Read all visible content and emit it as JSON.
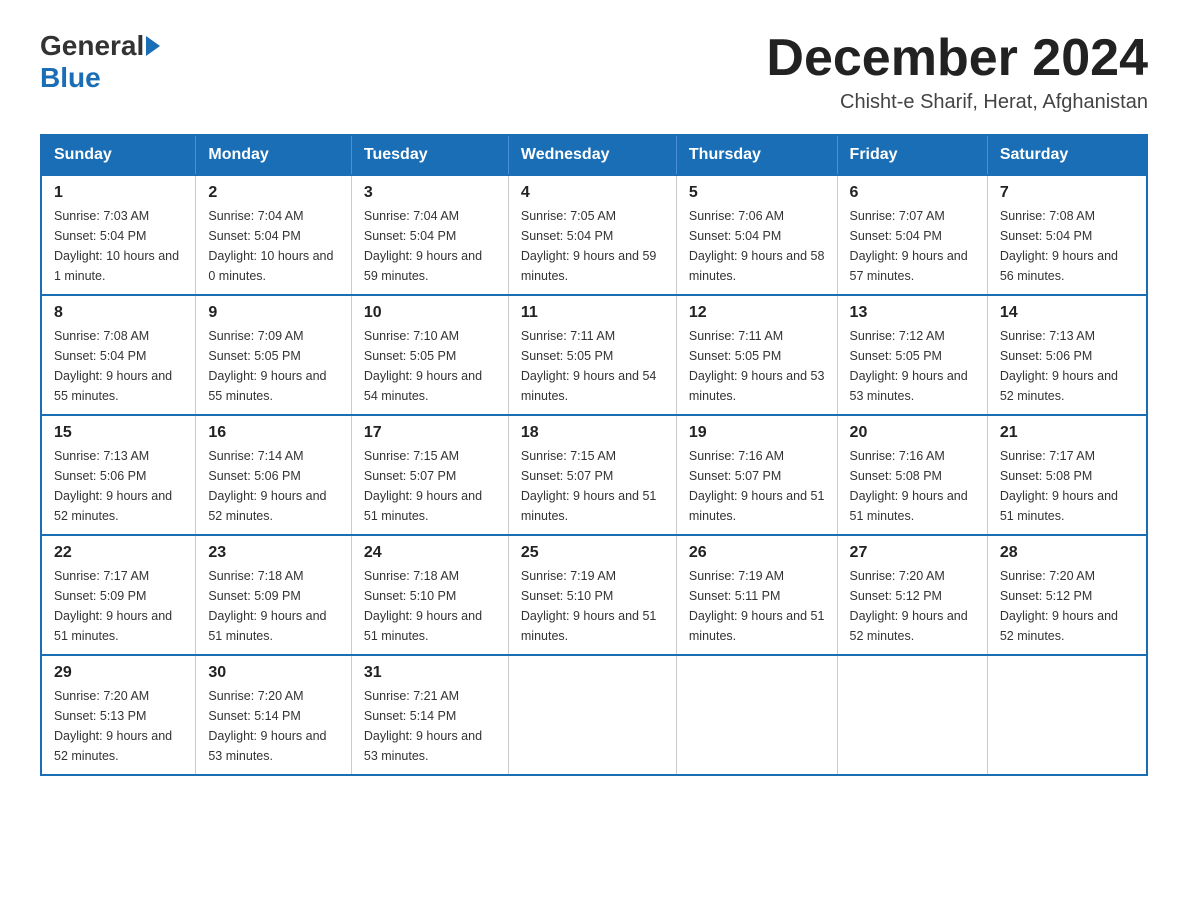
{
  "header": {
    "logo_text_general": "General",
    "logo_text_blue": "Blue",
    "month_title": "December 2024",
    "location": "Chisht-e Sharif, Herat, Afghanistan"
  },
  "days_of_week": [
    "Sunday",
    "Monday",
    "Tuesday",
    "Wednesday",
    "Thursday",
    "Friday",
    "Saturday"
  ],
  "weeks": [
    [
      {
        "day": "1",
        "sunrise": "7:03 AM",
        "sunset": "5:04 PM",
        "daylight": "10 hours and 1 minute."
      },
      {
        "day": "2",
        "sunrise": "7:04 AM",
        "sunset": "5:04 PM",
        "daylight": "10 hours and 0 minutes."
      },
      {
        "day": "3",
        "sunrise": "7:04 AM",
        "sunset": "5:04 PM",
        "daylight": "9 hours and 59 minutes."
      },
      {
        "day": "4",
        "sunrise": "7:05 AM",
        "sunset": "5:04 PM",
        "daylight": "9 hours and 59 minutes."
      },
      {
        "day": "5",
        "sunrise": "7:06 AM",
        "sunset": "5:04 PM",
        "daylight": "9 hours and 58 minutes."
      },
      {
        "day": "6",
        "sunrise": "7:07 AM",
        "sunset": "5:04 PM",
        "daylight": "9 hours and 57 minutes."
      },
      {
        "day": "7",
        "sunrise": "7:08 AM",
        "sunset": "5:04 PM",
        "daylight": "9 hours and 56 minutes."
      }
    ],
    [
      {
        "day": "8",
        "sunrise": "7:08 AM",
        "sunset": "5:04 PM",
        "daylight": "9 hours and 55 minutes."
      },
      {
        "day": "9",
        "sunrise": "7:09 AM",
        "sunset": "5:05 PM",
        "daylight": "9 hours and 55 minutes."
      },
      {
        "day": "10",
        "sunrise": "7:10 AM",
        "sunset": "5:05 PM",
        "daylight": "9 hours and 54 minutes."
      },
      {
        "day": "11",
        "sunrise": "7:11 AM",
        "sunset": "5:05 PM",
        "daylight": "9 hours and 54 minutes."
      },
      {
        "day": "12",
        "sunrise": "7:11 AM",
        "sunset": "5:05 PM",
        "daylight": "9 hours and 53 minutes."
      },
      {
        "day": "13",
        "sunrise": "7:12 AM",
        "sunset": "5:05 PM",
        "daylight": "9 hours and 53 minutes."
      },
      {
        "day": "14",
        "sunrise": "7:13 AM",
        "sunset": "5:06 PM",
        "daylight": "9 hours and 52 minutes."
      }
    ],
    [
      {
        "day": "15",
        "sunrise": "7:13 AM",
        "sunset": "5:06 PM",
        "daylight": "9 hours and 52 minutes."
      },
      {
        "day": "16",
        "sunrise": "7:14 AM",
        "sunset": "5:06 PM",
        "daylight": "9 hours and 52 minutes."
      },
      {
        "day": "17",
        "sunrise": "7:15 AM",
        "sunset": "5:07 PM",
        "daylight": "9 hours and 51 minutes."
      },
      {
        "day": "18",
        "sunrise": "7:15 AM",
        "sunset": "5:07 PM",
        "daylight": "9 hours and 51 minutes."
      },
      {
        "day": "19",
        "sunrise": "7:16 AM",
        "sunset": "5:07 PM",
        "daylight": "9 hours and 51 minutes."
      },
      {
        "day": "20",
        "sunrise": "7:16 AM",
        "sunset": "5:08 PM",
        "daylight": "9 hours and 51 minutes."
      },
      {
        "day": "21",
        "sunrise": "7:17 AM",
        "sunset": "5:08 PM",
        "daylight": "9 hours and 51 minutes."
      }
    ],
    [
      {
        "day": "22",
        "sunrise": "7:17 AM",
        "sunset": "5:09 PM",
        "daylight": "9 hours and 51 minutes."
      },
      {
        "day": "23",
        "sunrise": "7:18 AM",
        "sunset": "5:09 PM",
        "daylight": "9 hours and 51 minutes."
      },
      {
        "day": "24",
        "sunrise": "7:18 AM",
        "sunset": "5:10 PM",
        "daylight": "9 hours and 51 minutes."
      },
      {
        "day": "25",
        "sunrise": "7:19 AM",
        "sunset": "5:10 PM",
        "daylight": "9 hours and 51 minutes."
      },
      {
        "day": "26",
        "sunrise": "7:19 AM",
        "sunset": "5:11 PM",
        "daylight": "9 hours and 51 minutes."
      },
      {
        "day": "27",
        "sunrise": "7:20 AM",
        "sunset": "5:12 PM",
        "daylight": "9 hours and 52 minutes."
      },
      {
        "day": "28",
        "sunrise": "7:20 AM",
        "sunset": "5:12 PM",
        "daylight": "9 hours and 52 minutes."
      }
    ],
    [
      {
        "day": "29",
        "sunrise": "7:20 AM",
        "sunset": "5:13 PM",
        "daylight": "9 hours and 52 minutes."
      },
      {
        "day": "30",
        "sunrise": "7:20 AM",
        "sunset": "5:14 PM",
        "daylight": "9 hours and 53 minutes."
      },
      {
        "day": "31",
        "sunrise": "7:21 AM",
        "sunset": "5:14 PM",
        "daylight": "9 hours and 53 minutes."
      },
      null,
      null,
      null,
      null
    ]
  ]
}
